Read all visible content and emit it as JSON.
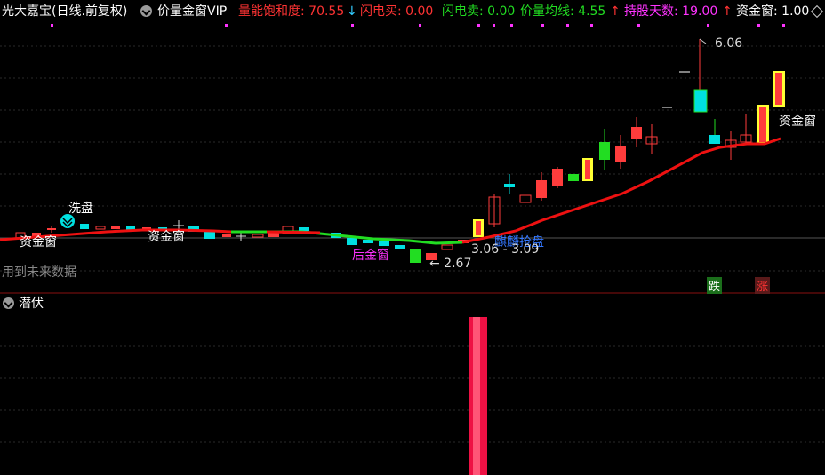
{
  "header": {
    "stock": "光大嘉宝(日线.前复权)",
    "indicator_name": "价量金窗VIP",
    "energy_label": "量能饱和度: 70.55",
    "energy_arrow": "↓",
    "flash_buy": "闪电买: 0.00",
    "flash_sell": "闪电卖: 0.00",
    "vol_ma": "价量均线: 4.55",
    "vol_ma_arrow": "↑",
    "hold_days": "持股天数: 19.00",
    "hold_days_arrow": "↑",
    "fund_window": "资金窗: 1.00"
  },
  "annotations": {
    "wash": "洗盘",
    "fund_window_1": "资金窗",
    "fund_window_2": "资金窗",
    "fund_window_3": "资金窗",
    "rear_window": "后金窗",
    "qilin": "麒麟抢盘",
    "low_price": "← 2.67",
    "range": "3.06 - 3.09",
    "high_price": "6.06",
    "future_data": "用到未来数据",
    "fall_badge": "跌",
    "rise_badge": "涨"
  },
  "sub_panel": {
    "title": "潜伏"
  },
  "colors": {
    "up": "#ff3c3c",
    "down": "#00e0e0",
    "green_line": "#22dd22",
    "red_line": "#ee1111",
    "yellow": "#ffff33",
    "magenta": "#ff33ff",
    "hdr_red": "#ff3333",
    "hdr_green": "#22dd22"
  }
}
